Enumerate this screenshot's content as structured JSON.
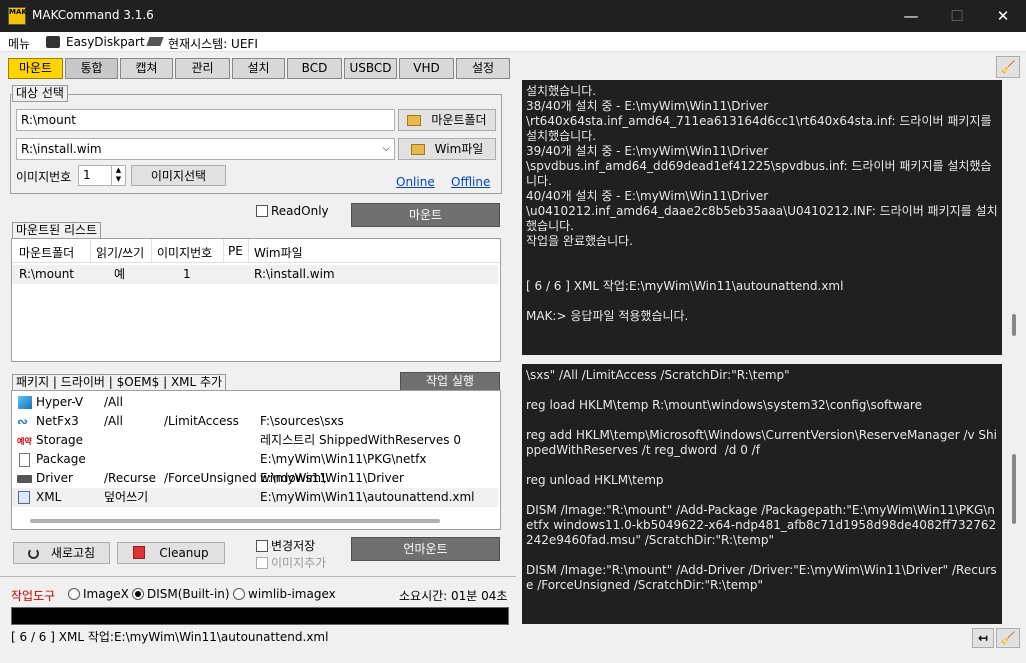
{
  "window": {
    "title": "MAKCommand 3.1.6",
    "min": "—",
    "max": "☐",
    "close": "✕",
    "icon_text": "MAK"
  },
  "menu": {
    "menu": "메뉴",
    "easydiskpart": "EasyDiskpart",
    "current_system": "현재시스템: UEFI"
  },
  "tabs": [
    "마운트",
    "통합",
    "캡쳐",
    "관리",
    "설치",
    "BCD",
    "USBCD",
    "VHD",
    "설정"
  ],
  "target": {
    "group_label": "대상 선택",
    "mount_path": "R:\\mount",
    "mount_folder_btn": "마운트폴더",
    "wim_path": "R:\\install.wim",
    "wim_btn": "Wim파일",
    "image_num_label": "이미지번호",
    "image_num": "1",
    "image_select_btn": "이미지선택",
    "online": "Online",
    "offline": "Offline",
    "readonly": "ReadOnly",
    "mount_btn": "마운트"
  },
  "mounted": {
    "group_label": "마운트된 리스트",
    "headers": [
      "마운트폴더",
      "읽기/쓰기",
      "이미지번호",
      "PE",
      "Wim파일"
    ],
    "rows": [
      [
        "R:\\mount",
        "예",
        "1",
        "",
        "R:\\install.wim"
      ]
    ]
  },
  "packages": {
    "group_label": "패키지 | 드라이버 | $OEM$ | XML 추가",
    "run_btn": "작업 실행",
    "rows": [
      {
        "name": "Hyper-V",
        "opt1": "/All",
        "opt2": "",
        "path": ""
      },
      {
        "name": "NetFx3",
        "opt1": "/All",
        "opt2": "/LimitAccess",
        "path": "F:\\sources\\sxs"
      },
      {
        "name": "Storage",
        "opt1": "",
        "opt2": "",
        "path": "레지스트리 ShippedWithReserves 0"
      },
      {
        "name": "Package",
        "opt1": "",
        "opt2": "",
        "path": "E:\\myWim\\Win11\\PKG\\netfx windows11."
      },
      {
        "name": "Driver",
        "opt1": "/Recurse",
        "opt2": "/ForceUnsigned",
        "path": "E:\\myWim\\Win11\\Driver"
      },
      {
        "name": "XML",
        "opt1": "덮어쓰기",
        "opt2": "",
        "path": "E:\\myWim\\Win11\\autounattend.xml"
      }
    ],
    "storage_icon_text": "예약"
  },
  "bottom": {
    "refresh_btn": "새로고침",
    "cleanup_btn": "Cleanup",
    "save_changes": "변경저장",
    "add_image": "이미지추가",
    "unmount_btn": "언마운트",
    "tool_label": "작업도구",
    "imagex": "ImageX",
    "dism": "DISM(Built-in)",
    "wimlib": "wimlib-imagex",
    "elapsed": "소요시간: 01분 04초",
    "status": "[ 6 / 6 ] XML 작업:E:\\myWim\\Win11\\autounattend.xml"
  },
  "log_top": [
    "설치했습니다.",
    "38/40개 설치 중 - E:\\myWim\\Win11\\Driver\n\\rt640x64sta.inf_amd64_711ea613164d6cc1\\rt640x64sta.inf: 드라이버 패키지를 설치했습니다.",
    "39/40개 설치 중 - E:\\myWim\\Win11\\Driver\n\\spvdbus.inf_amd64_dd69dead1ef41225\\spvdbus.inf: 드라이버 패키지를 설치했습니다.",
    "40/40개 설치 중 - E:\\myWim\\Win11\\Driver\n\\u0410212.inf_amd64_daae2c8b5eb35aaa\\U0410212.INF: 드라이버 패키지를 설치했습니다.",
    "작업을 완료했습니다.",
    "\n\n[ 6 / 6 ] XML 작업:E:\\myWim\\Win11\\autounattend.xml\n\nMAK:> 응답파일 적용했습니다."
  ],
  "log_bottom": [
    "\\sxs\" /All /LimitAccess /ScratchDir:\"R:\\temp\"\n\nreg load HKLM\\temp R:\\mount\\windows\\system32\\config\\software\n\nreg add HKLM\\temp\\Microsoft\\Windows\\CurrentVersion\\ReserveManager /v ShippedWithReserves /t reg_dword  /d 0 /f\n\nreg unload HKLM\\temp\n\nDISM /Image:\"R:\\mount\" /Add-Package /Packagepath:\"E:\\myWim\\Win11\\PKG\\netfx windows11.0-kb5049622-x64-ndp481_afb8c71d1958d98de4082ff732762242e9460fad.msu\" /ScratchDir:\"R:\\temp\"\n\nDISM /Image:\"R:\\mount\" /Add-Driver /Driver:\"E:\\myWim\\Win11\\Driver\" /Recurse /ForceUnsigned /ScratchDir:\"R:\\temp\""
  ],
  "colors": {
    "accent_tab": "#ffd400",
    "titlebar": "#202020",
    "log_bg": "#202020",
    "tool_label": "#cc0000"
  }
}
